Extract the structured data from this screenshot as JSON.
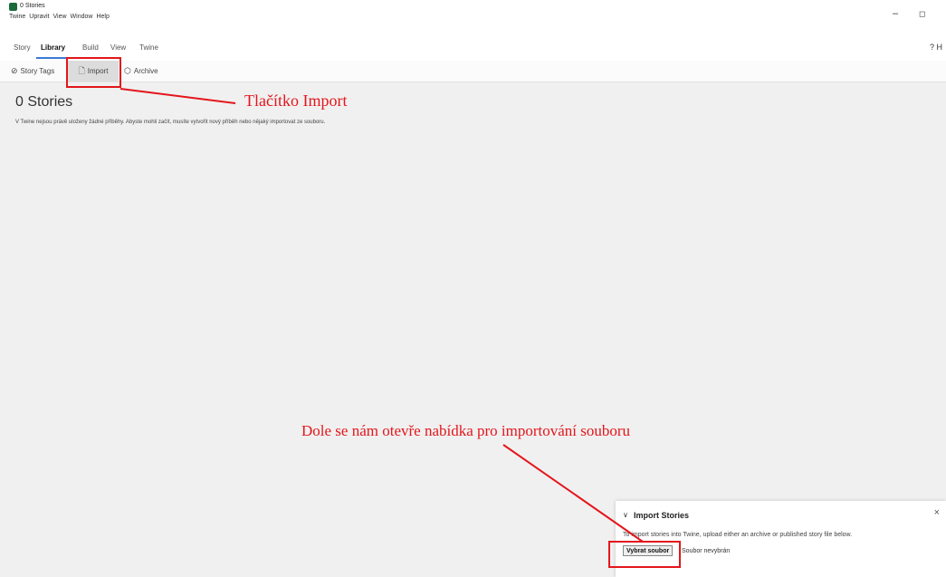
{
  "window": {
    "title": "0 Stories",
    "menu": [
      "Twine",
      "Upravit",
      "View",
      "Window",
      "Help"
    ],
    "minimize_glyph": "–",
    "restore_glyph": "◻"
  },
  "tabs": [
    {
      "label": "Story"
    },
    {
      "label": "Library"
    },
    {
      "label": "Build"
    },
    {
      "label": "View"
    },
    {
      "label": "Twine"
    }
  ],
  "help_label": "? H",
  "toolbar": {
    "story_tags": "Story Tags",
    "import": "Import",
    "archive": "Archive"
  },
  "main": {
    "title": "0 Stories",
    "description": "V Twine nejsou právě uloženy žádné příběhy. Abyste mohli začít, musíte vytvořit nový příběh nebo nějaký importovat ze souboru."
  },
  "import_dialog": {
    "title": "Import Stories",
    "text": "To import stories into Twine, upload either an archive or published story file below.",
    "file_button": "Vybrat soubor",
    "file_status": "Soubor nevybrán",
    "close_glyph": "×",
    "collapse_glyph": "∨"
  },
  "annotations": {
    "import_label": "Tlačítko Import",
    "dialog_label": "Dole se nám otevře nabídka pro importování souboru",
    "color": "#e3161c"
  },
  "colors": {
    "accent": "#3a7bd5",
    "app_icon": "#1a6b3a",
    "background": "#f0f0f0"
  }
}
